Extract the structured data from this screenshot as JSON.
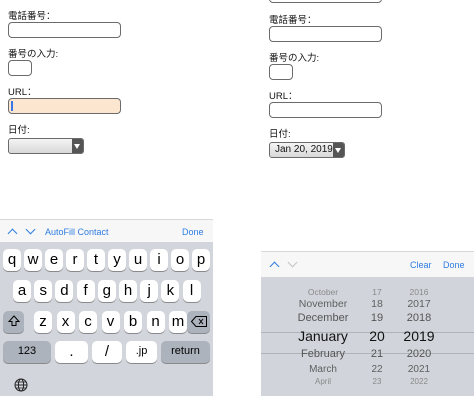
{
  "left_form": {
    "phone_label": "電話番号：",
    "number_label": "番号の入力:",
    "url_label": "URL：",
    "date_label": "日付:"
  },
  "right_form": {
    "phone_label": "電話番号：",
    "number_label": "番号の入力:",
    "url_label": "URL：",
    "date_label": "日付:",
    "date_value": "Jan 20, 2019"
  },
  "keyboard_toolbar": {
    "autofill_label": "AutoFill Contact",
    "done_label": "Done"
  },
  "keyboard": {
    "row1": [
      "q",
      "w",
      "e",
      "r",
      "t",
      "y",
      "u",
      "i",
      "o",
      "p"
    ],
    "row2": [
      "a",
      "s",
      "d",
      "f",
      "g",
      "h",
      "j",
      "k",
      "l"
    ],
    "row3": [
      "z",
      "x",
      "c",
      "v",
      "b",
      "n",
      "m"
    ],
    "numbers_label": "123",
    "dot_label": ".",
    "slash_label": "/",
    "jp_label": ".jp",
    "return_label": "return",
    "shift_icon": "shift-icon",
    "backspace_icon": "backspace-icon",
    "globe_icon": "globe-icon"
  },
  "picker_toolbar": {
    "clear_label": "Clear",
    "done_label": "Done"
  },
  "date_picker": {
    "months": [
      "October",
      "November",
      "December",
      "January",
      "February",
      "March",
      "April"
    ],
    "days": [
      "17",
      "18",
      "19",
      "20",
      "21",
      "22",
      "23"
    ],
    "years": [
      "2016",
      "2017",
      "2018",
      "2019",
      "2020",
      "2021",
      "2022"
    ],
    "selected_index": 3
  },
  "colors": {
    "accent": "#2f7de1",
    "url_focus_bg": "#fde6cf",
    "url_focus_border": "#3b78e7",
    "keyboard_bg": "#d2d5db",
    "picker_bg": "#d1d4da"
  }
}
